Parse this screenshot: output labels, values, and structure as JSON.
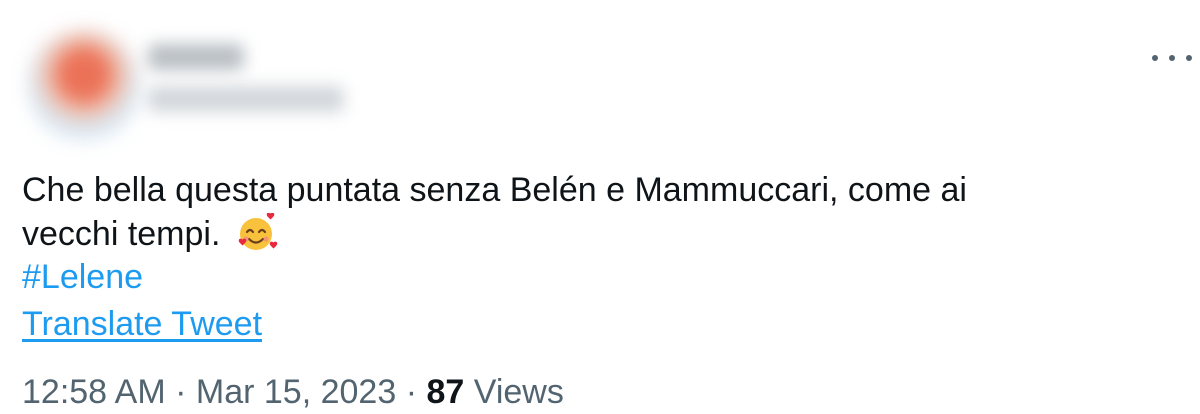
{
  "tweet": {
    "text_line1": "Che bella questa puntata senza Belén e Mammuccari, come ai",
    "text_line2": "vecchi tempi.",
    "emoji": "smiling-face-with-hearts-icon",
    "hashtag": "#Lelene",
    "translate_label": "Translate Tweet",
    "time": "12:58 AM",
    "separator": "·",
    "date": "Mar 15, 2023",
    "views_count": "87",
    "views_label": "Views"
  },
  "colors": {
    "link": "#1d9bf0",
    "text": "#0f1419",
    "muted": "#536471"
  }
}
